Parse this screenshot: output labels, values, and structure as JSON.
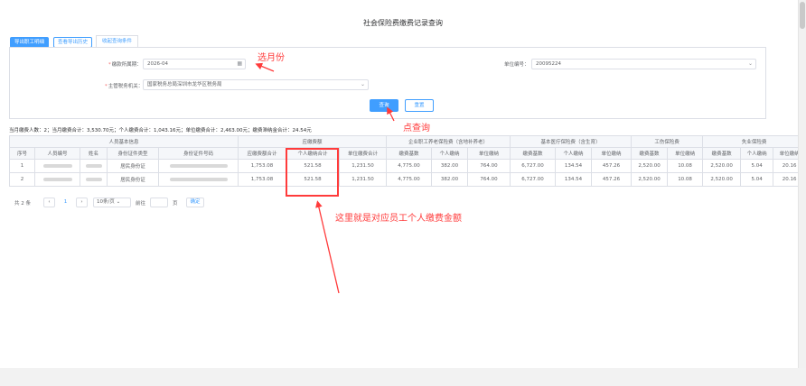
{
  "page": {
    "title": "社会保险费缴费记录查询"
  },
  "toolbar": {
    "export_employee_label": "导出职工明细",
    "export_history_label": "查看导出历史"
  },
  "tab": {
    "label": "收起查询条件"
  },
  "form": {
    "period_label": "缴款所属期：",
    "period_value": "2026-04",
    "unit_label": "单位编号：",
    "unit_value": "20095224",
    "tax_label": "主管税务机关：",
    "tax_value": "国家税务总局深圳市龙华区税务局",
    "query_label": "查询",
    "reset_label": "重置"
  },
  "summary": "当月缴费人数：2；当月缴费合计：3,530.70元；个人缴费合计：1,043.16元；单位缴费合计：2,463.00元；缴费滞纳金合计：24.54元",
  "table": {
    "group_headers": [
      "人员基本信息",
      "应缴费额",
      "企业职工养老保险费（含地补养老）",
      "基本医疗保险费（含生育）",
      "工伤保险费",
      "失业保险费"
    ],
    "columns": [
      "序号",
      "人员编号",
      "姓名",
      "身份证件类型",
      "身份证件号码",
      "应缴费额合计",
      "个人缴纳合计",
      "单位缴费合计",
      "缴费基数",
      "个人缴纳",
      "单位缴纳",
      "缴费基数",
      "个人缴纳",
      "单位缴纳",
      "缴费基数",
      "单位缴纳",
      "缴费基数",
      "个人缴纳",
      "单位缴纳"
    ],
    "rows": [
      {
        "seq": "1",
        "id_type": "居民身份证",
        "total": "1,753.08",
        "personal_total": "521.58",
        "unit_total": "1,231.50",
        "p_base": "4,775.00",
        "p_personal": "382.00",
        "p_unit": "764.00",
        "m_base": "6,727.00",
        "m_personal": "134.54",
        "m_unit": "457.26",
        "i_base": "2,520.00",
        "i_unit": "10.08",
        "u_base": "2,520.00",
        "u_personal": "5.04",
        "u_unit": "20.16"
      },
      {
        "seq": "2",
        "id_type": "居民身份证",
        "total": "1,753.08",
        "personal_total": "521.58",
        "unit_total": "1,231.50",
        "p_base": "4,775.00",
        "p_personal": "382.00",
        "p_unit": "764.00",
        "m_base": "6,727.00",
        "m_personal": "134.54",
        "m_unit": "457.26",
        "i_base": "2,520.00",
        "i_unit": "10.08",
        "u_base": "2,520.00",
        "u_personal": "5.04",
        "u_unit": "20.16"
      }
    ]
  },
  "pager": {
    "total_text": "共 2 条",
    "prev_icon": "chevron-left-icon",
    "current_page": "1",
    "next_icon": "chevron-right-icon",
    "page_size": "10条/页",
    "goto_label": "前往",
    "page_unit": "页",
    "confirm_label": "确定"
  },
  "annotations": {
    "select_month": "选月份",
    "click_query": "点查询",
    "personal_note": "这里就是对应员工个人缴费金额",
    "color": "#ff3b3b"
  }
}
